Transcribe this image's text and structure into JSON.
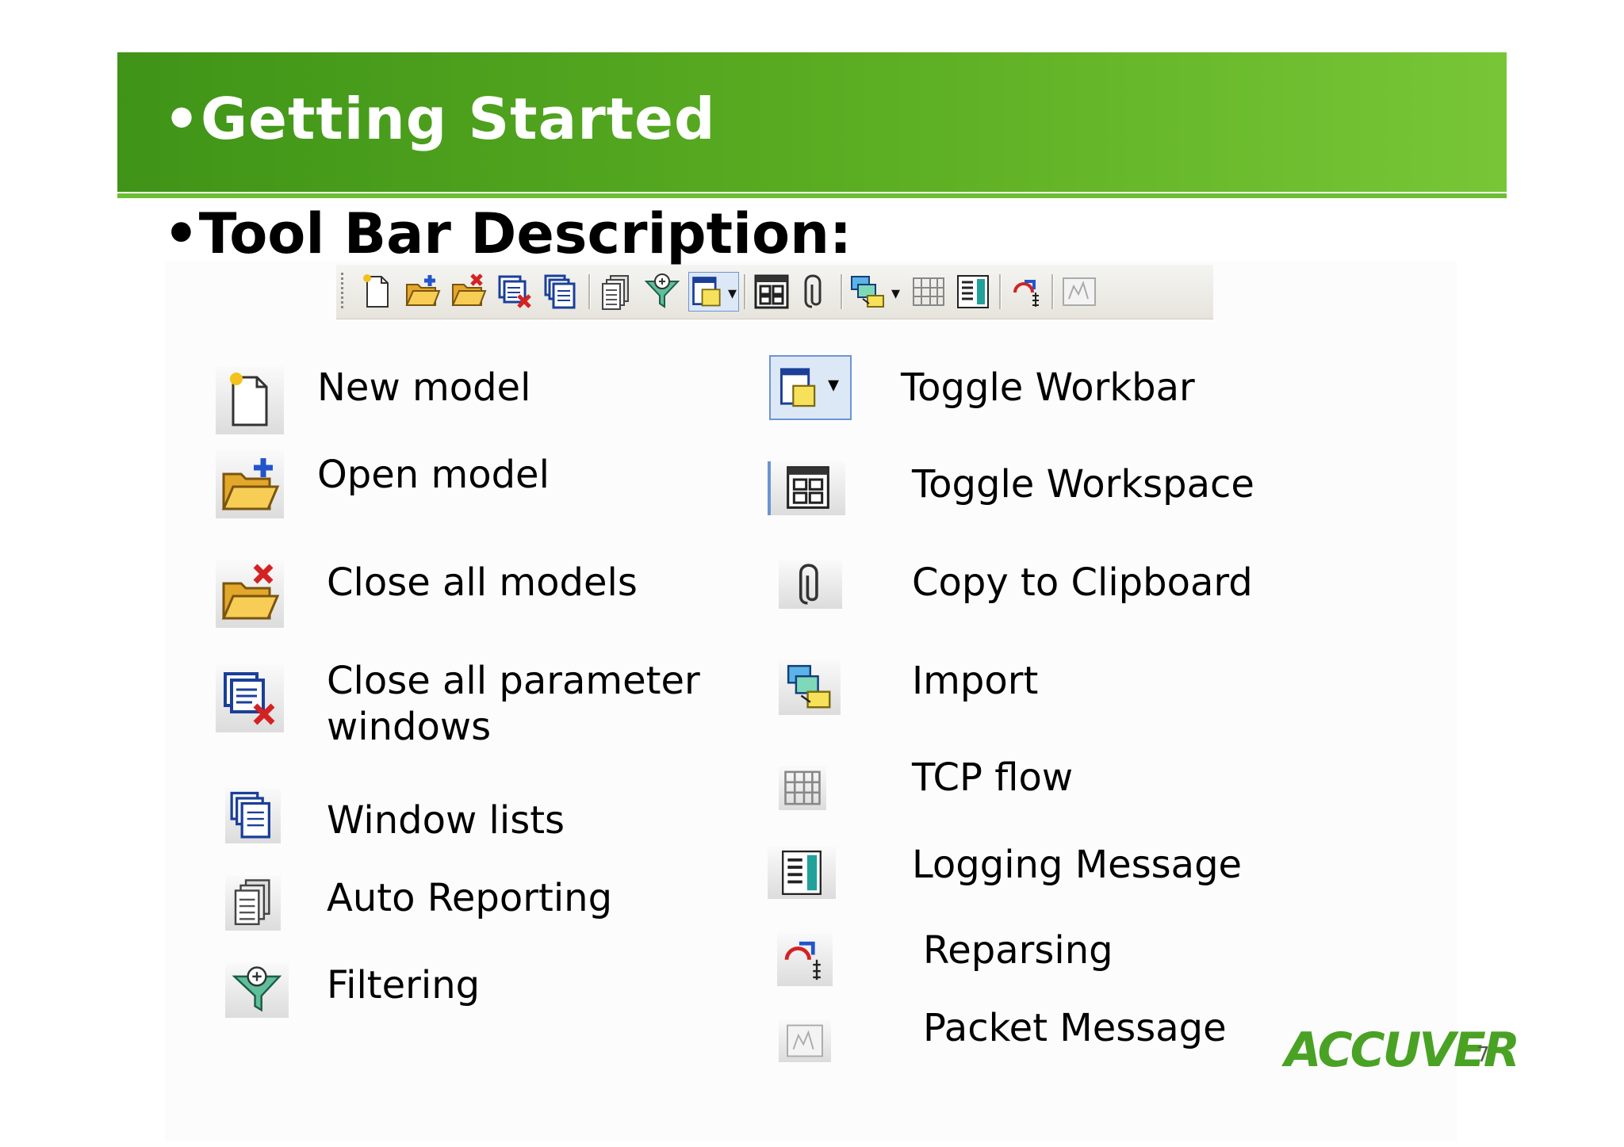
{
  "slide": {
    "title": "•Getting Started",
    "subtitle": "•Tool Bar Description:",
    "logo_text": "ACCUVER",
    "page_number": "7",
    "accent_color": "#5cae22"
  },
  "toolbar": {
    "icons": [
      "new-model-icon",
      "open-model-icon",
      "close-all-models-icon",
      "close-all-parameter-windows-icon",
      "window-lists-icon",
      "auto-reporting-icon",
      "filtering-icon",
      "toggle-workbar-icon",
      "toggle-workspace-icon",
      "copy-to-clipboard-icon",
      "import-icon",
      "tcp-flow-icon",
      "logging-message-icon",
      "reparsing-icon",
      "packet-message-icon"
    ]
  },
  "legend": {
    "left": [
      {
        "icon": "new-model-icon",
        "label": "New model"
      },
      {
        "icon": "open-model-icon",
        "label": "Open model"
      },
      {
        "icon": "close-all-models-icon",
        "label": "Close all models"
      },
      {
        "icon": "close-all-parameter-windows-icon",
        "label_line1": "Close all parameter",
        "label_line2": "windows"
      },
      {
        "icon": "window-lists-icon",
        "label": "Window lists"
      },
      {
        "icon": "auto-reporting-icon",
        "label": "Auto Reporting"
      },
      {
        "icon": "filtering-icon",
        "label": "Filtering"
      }
    ],
    "right": [
      {
        "icon": "toggle-workbar-icon",
        "label": "Toggle Workbar"
      },
      {
        "icon": "toggle-workspace-icon",
        "label": "Toggle Workspace"
      },
      {
        "icon": "copy-to-clipboard-icon",
        "label": "Copy to Clipboard"
      },
      {
        "icon": "import-icon",
        "label": "Import"
      },
      {
        "icon": "tcp-flow-icon",
        "label": "TCP flow"
      },
      {
        "icon": "logging-message-icon",
        "label": "Logging Message"
      },
      {
        "icon": "reparsing-icon",
        "label": "Reparsing"
      },
      {
        "icon": "packet-message-icon",
        "label": "Packet Message"
      }
    ]
  }
}
